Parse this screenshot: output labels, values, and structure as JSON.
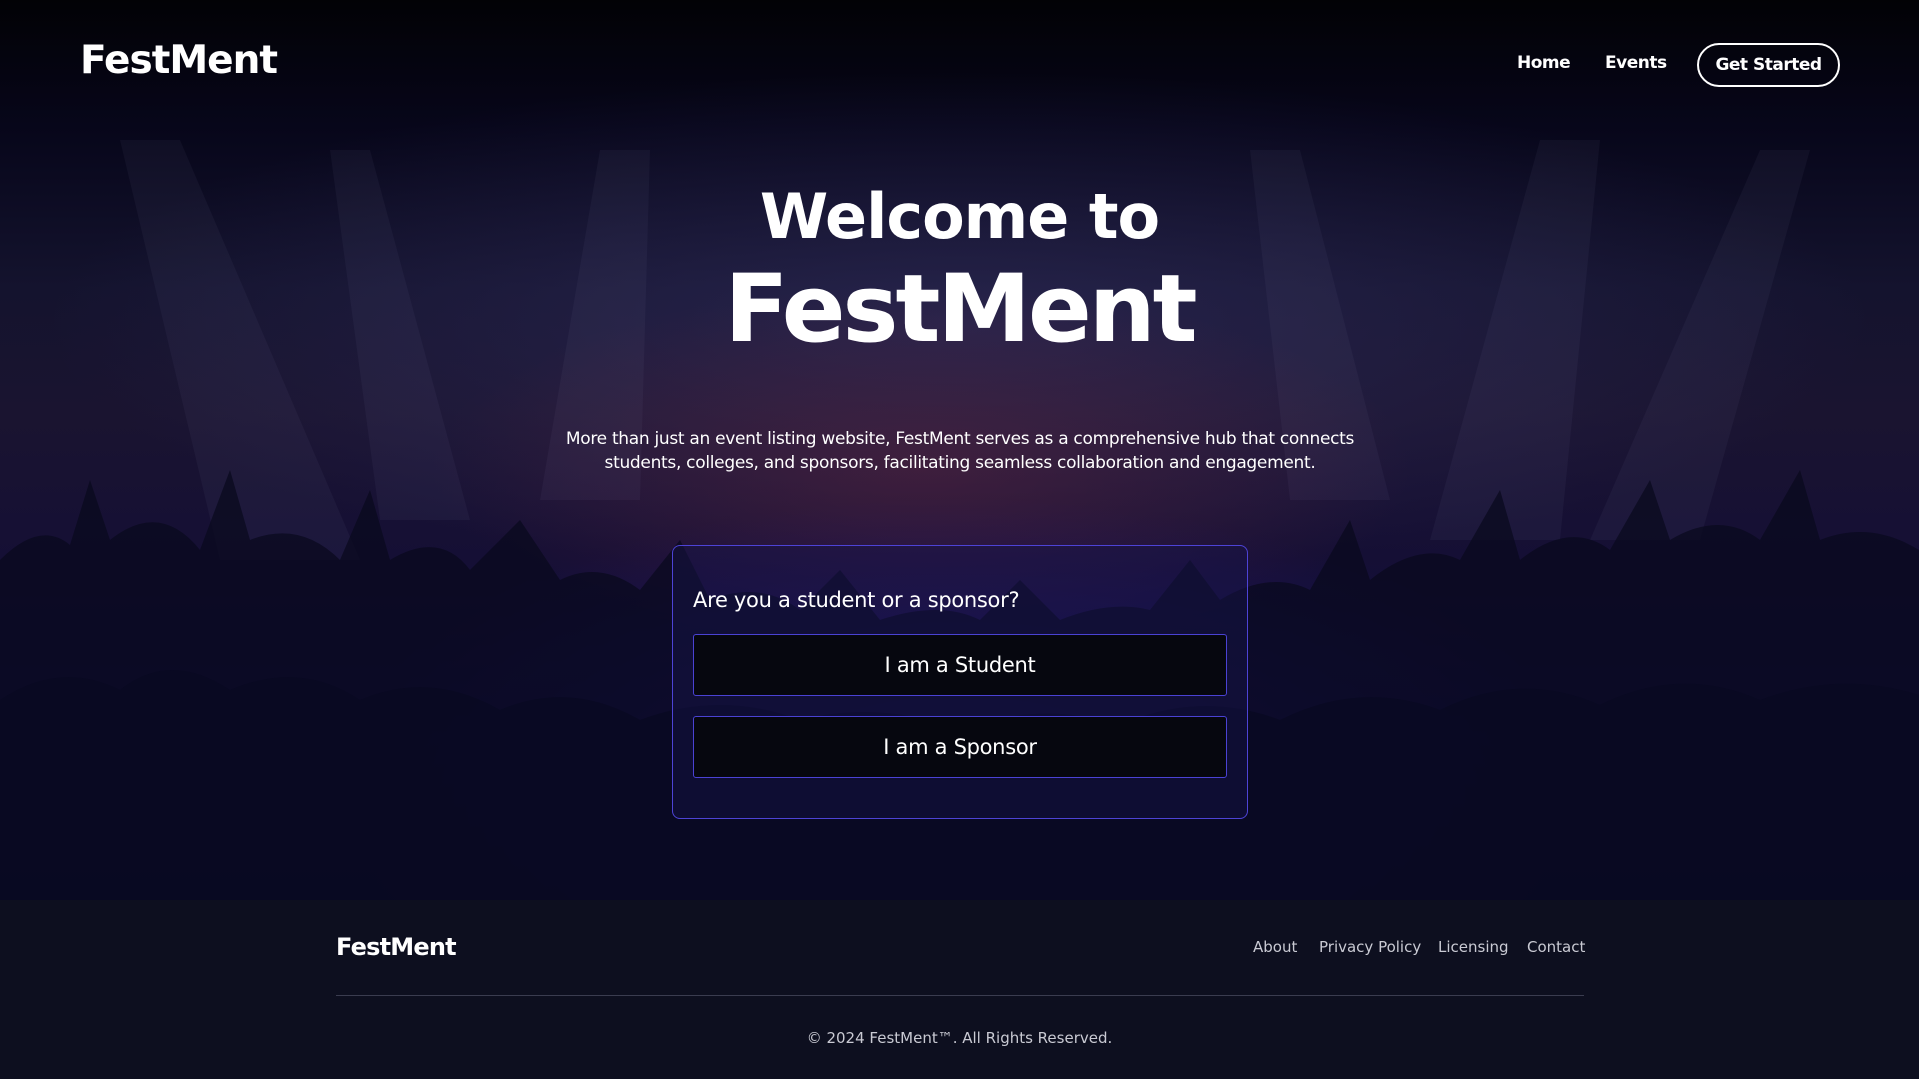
{
  "nav": {
    "brand": "FestMent",
    "links": [
      "Home",
      "Events"
    ],
    "cta_label": "Get Started"
  },
  "hero": {
    "welcome": "Welcome to",
    "title": "FestMent",
    "description": "More than just an event listing website, FestMent serves as a comprehensive hub that connects students, colleges, and sponsors, facilitating seamless collaboration and engagement."
  },
  "role_card": {
    "question": "Are you a student or a sponsor?",
    "student_label": "I am a Student",
    "sponsor_label": "I am a Sponsor"
  },
  "footer": {
    "brand": "FestMent",
    "links": [
      "About",
      "Privacy Policy",
      "Licensing",
      "Contact"
    ],
    "copyright": "© 2024 FestMent™. All Rights Reserved."
  },
  "colors": {
    "accent_border": "#4d43d6",
    "footer_bg": "#0d0f1f",
    "button_bg": "#06070f"
  }
}
